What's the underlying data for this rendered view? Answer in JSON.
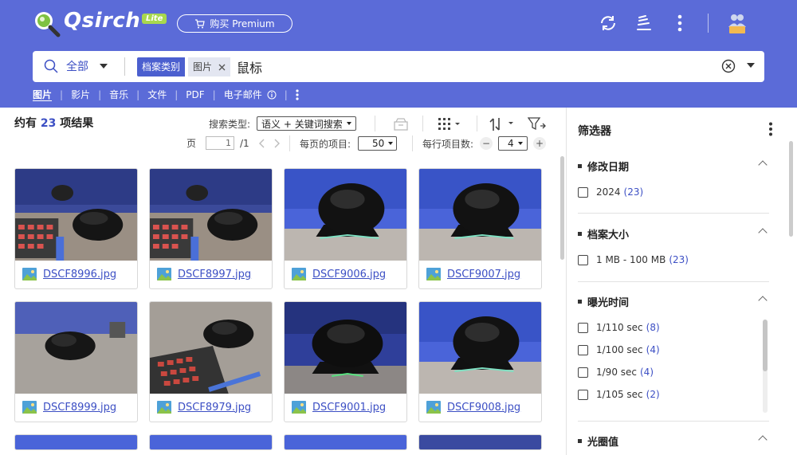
{
  "header": {
    "logo_text": "Qsirch",
    "badge": "Lite",
    "premium_label": "购买 Premium",
    "bg_color": "#5b6bd8"
  },
  "search": {
    "scope_label": "全部",
    "chip_category": "档案类别",
    "chip_value": "图片",
    "query": "鼠标"
  },
  "tabs": [
    {
      "label": "图片",
      "active": true
    },
    {
      "label": "影片"
    },
    {
      "label": "音乐"
    },
    {
      "label": "文件"
    },
    {
      "label": "PDF"
    },
    {
      "label": "电子邮件"
    }
  ],
  "results": {
    "prefix": "约有",
    "count": "23",
    "suffix": "项结果"
  },
  "toolbar": {
    "search_type_label": "搜索类型:",
    "search_type_value": "语义 + 关键词搜索",
    "page_label": "页",
    "page_value": "1",
    "page_total": "/1",
    "per_page_label": "每页的项目:",
    "per_page_value": "50",
    "per_row_label": "每行项目数:",
    "per_row_value": "4"
  },
  "cards": [
    {
      "name": "DSCF8996.jpg",
      "scene": "keyboard-mouse"
    },
    {
      "name": "DSCF8997.jpg",
      "scene": "keyboard-mouse"
    },
    {
      "name": "DSCF9006.jpg",
      "scene": "mouse-dock"
    },
    {
      "name": "DSCF9007.jpg",
      "scene": "mouse-dock"
    },
    {
      "name": "DSCF8999.jpg",
      "scene": "mouse-felt"
    },
    {
      "name": "DSCF8979.jpg",
      "scene": "keyboard-felt"
    },
    {
      "name": "DSCF9001.jpg",
      "scene": "mouse-dock-dark"
    },
    {
      "name": "DSCF9008.jpg",
      "scene": "mouse-dock"
    }
  ],
  "panel": {
    "title": "筛选器",
    "sections": [
      {
        "title": "修改日期",
        "options": [
          {
            "label": "2024",
            "count": "(23)"
          }
        ]
      },
      {
        "title": "档案大小",
        "options": [
          {
            "label": "1 MB - 100 MB",
            "count": "(23)"
          }
        ]
      },
      {
        "title": "曝光时间",
        "options": [
          {
            "label": "1/110 sec",
            "count": "(8)"
          },
          {
            "label": "1/100 sec",
            "count": "(4)"
          },
          {
            "label": "1/90 sec",
            "count": "(4)"
          },
          {
            "label": "1/105 sec",
            "count": "(2)"
          }
        ]
      },
      {
        "title": "光圈值",
        "options": []
      }
    ]
  },
  "colors": {
    "accent": "#3c4fc4",
    "chip": "#4b5fcf"
  }
}
